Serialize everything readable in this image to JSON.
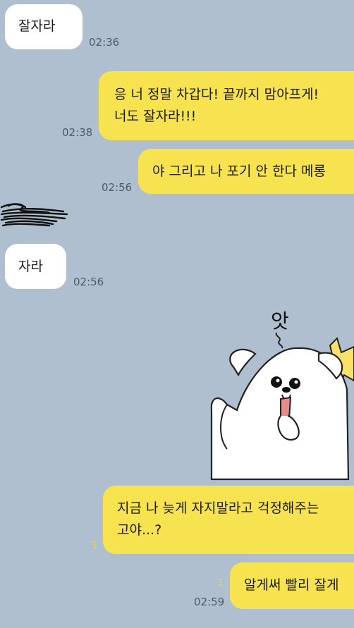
{
  "chat": {
    "messages": [
      {
        "id": "m1",
        "side": "in",
        "text": "잘자라",
        "time": "02:36"
      },
      {
        "id": "m2",
        "side": "out",
        "lines": [
          "응 너 정말 차갑다! 끝까지 맘아프게!",
          "너도 잘자라!!!"
        ],
        "time": "02:38"
      },
      {
        "id": "m3",
        "side": "out",
        "text": "야 그리고 나 포기 안 한다 메롱",
        "time": "02:56"
      },
      {
        "id": "m4",
        "side": "in",
        "text": "자라",
        "time": "02:56"
      },
      {
        "id": "m5",
        "side": "out",
        "type": "sticker",
        "sticker_text": "앗"
      },
      {
        "id": "m6",
        "side": "out",
        "lines": [
          "지금 나 늦게 자지말라고 걱정해주는",
          "고야...?"
        ],
        "unread": "1"
      },
      {
        "id": "m7",
        "side": "out",
        "text": "알게써 빨리 잘게",
        "time": "02:59",
        "unread": "1"
      }
    ]
  },
  "colors": {
    "background": "#afbfd0",
    "incoming_bubble": "#ffffff",
    "outgoing_bubble": "#f7e34f",
    "timestamp": "#4f5a66",
    "unread_count": "#e8d65a"
  }
}
